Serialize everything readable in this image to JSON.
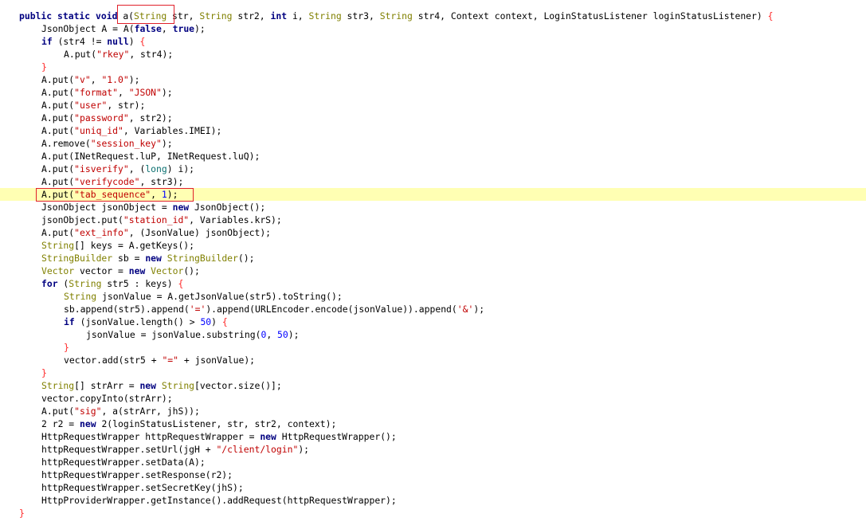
{
  "editor": {
    "highlighted_line": 15,
    "colors": {
      "keyword": "#000080",
      "type": "#808000",
      "string": "#c00000",
      "number": "#0000ff",
      "brace": "#ff2a2a",
      "cast": "#0b7070",
      "highlight_background": "#ffffb3",
      "annotation_box": "#e0202a"
    },
    "lines": [
      {
        "indent": 0,
        "tokens": [
          [
            "kw",
            "public static void "
          ],
          [
            "id",
            "a("
          ],
          [
            "type",
            "String"
          ],
          [
            "id",
            " str, "
          ],
          [
            "type",
            "String"
          ],
          [
            "id",
            " str2, "
          ],
          [
            "kw",
            "int"
          ],
          [
            "id",
            " i, "
          ],
          [
            "type",
            "String"
          ],
          [
            "id",
            " str3, "
          ],
          [
            "type",
            "String"
          ],
          [
            "id",
            " str4, Context context, LoginStatusListener loginStatusListener) "
          ],
          [
            "brace",
            "{"
          ]
        ]
      },
      {
        "indent": 4,
        "tokens": [
          [
            "id",
            "JsonObject A = A("
          ],
          [
            "kw",
            "false"
          ],
          [
            "id",
            ", "
          ],
          [
            "kw",
            "true"
          ],
          [
            "id",
            ");"
          ]
        ]
      },
      {
        "indent": 4,
        "tokens": [
          [
            "kw",
            "if"
          ],
          [
            "id",
            " (str4 != "
          ],
          [
            "kw",
            "null"
          ],
          [
            "id",
            ") "
          ],
          [
            "brace",
            "{"
          ]
        ]
      },
      {
        "indent": 8,
        "tokens": [
          [
            "id",
            "A.put("
          ],
          [
            "str",
            "\"rkey\""
          ],
          [
            "id",
            ", str4);"
          ]
        ]
      },
      {
        "indent": 4,
        "tokens": [
          [
            "brace",
            "}"
          ]
        ]
      },
      {
        "indent": 4,
        "tokens": [
          [
            "id",
            "A.put("
          ],
          [
            "str",
            "\"v\""
          ],
          [
            "id",
            ", "
          ],
          [
            "str",
            "\"1.0\""
          ],
          [
            "id",
            ");"
          ]
        ]
      },
      {
        "indent": 4,
        "tokens": [
          [
            "id",
            "A.put("
          ],
          [
            "str",
            "\"format\""
          ],
          [
            "id",
            ", "
          ],
          [
            "str",
            "\"JSON\""
          ],
          [
            "id",
            ");"
          ]
        ]
      },
      {
        "indent": 4,
        "tokens": [
          [
            "id",
            "A.put("
          ],
          [
            "str",
            "\"user\""
          ],
          [
            "id",
            ", str);"
          ]
        ]
      },
      {
        "indent": 4,
        "tokens": [
          [
            "id",
            "A.put("
          ],
          [
            "str",
            "\"password\""
          ],
          [
            "id",
            ", str2);"
          ]
        ]
      },
      {
        "indent": 4,
        "tokens": [
          [
            "id",
            "A.put("
          ],
          [
            "str",
            "\"uniq_id\""
          ],
          [
            "id",
            ", Variables.IMEI);"
          ]
        ]
      },
      {
        "indent": 4,
        "tokens": [
          [
            "id",
            "A.remove("
          ],
          [
            "str",
            "\"session_key\""
          ],
          [
            "id",
            ");"
          ]
        ]
      },
      {
        "indent": 4,
        "tokens": [
          [
            "id",
            "A.put(INetRequest.luP, INetRequest.luQ);"
          ]
        ]
      },
      {
        "indent": 4,
        "tokens": [
          [
            "id",
            "A.put("
          ],
          [
            "str",
            "\"isverify\""
          ],
          [
            "id",
            ", ("
          ],
          [
            "cast",
            "long"
          ],
          [
            "id",
            ") i);"
          ]
        ]
      },
      {
        "indent": 4,
        "tokens": [
          [
            "id",
            "A.put("
          ],
          [
            "str",
            "\"verifycode\""
          ],
          [
            "id",
            ", str3);"
          ]
        ]
      },
      {
        "indent": 4,
        "tokens": [
          [
            "id",
            "A.put("
          ],
          [
            "str",
            "\"tab_sequence\""
          ],
          [
            "id",
            ", "
          ],
          [
            "num",
            "1"
          ],
          [
            "id",
            ");"
          ]
        ]
      },
      {
        "indent": 4,
        "tokens": [
          [
            "id",
            "JsonObject jsonObject = "
          ],
          [
            "kw",
            "new"
          ],
          [
            "id",
            " JsonObject();"
          ]
        ]
      },
      {
        "indent": 4,
        "tokens": [
          [
            "id",
            "jsonObject.put("
          ],
          [
            "str",
            "\"station_id\""
          ],
          [
            "id",
            ", Variables.krS);"
          ]
        ]
      },
      {
        "indent": 4,
        "tokens": [
          [
            "id",
            "A.put("
          ],
          [
            "str",
            "\"ext_info\""
          ],
          [
            "id",
            ", (JsonValue) jsonObject);"
          ]
        ]
      },
      {
        "indent": 4,
        "tokens": [
          [
            "type",
            "String"
          ],
          [
            "id",
            "[] keys = A.getKeys();"
          ]
        ]
      },
      {
        "indent": 4,
        "tokens": [
          [
            "type",
            "StringBuilder"
          ],
          [
            "id",
            " sb = "
          ],
          [
            "kw",
            "new"
          ],
          [
            "id",
            " "
          ],
          [
            "type",
            "StringBuilder"
          ],
          [
            "id",
            "();"
          ]
        ]
      },
      {
        "indent": 4,
        "tokens": [
          [
            "type",
            "Vector"
          ],
          [
            "id",
            " vector = "
          ],
          [
            "kw",
            "new"
          ],
          [
            "id",
            " "
          ],
          [
            "type",
            "Vector"
          ],
          [
            "id",
            "();"
          ]
        ]
      },
      {
        "indent": 4,
        "tokens": [
          [
            "kw",
            "for"
          ],
          [
            "id",
            " ("
          ],
          [
            "type",
            "String"
          ],
          [
            "id",
            " str5 : keys) "
          ],
          [
            "brace",
            "{"
          ]
        ]
      },
      {
        "indent": 8,
        "tokens": [
          [
            "type",
            "String"
          ],
          [
            "id",
            " jsonValue = A.getJsonValue(str5).toString();"
          ]
        ]
      },
      {
        "indent": 8,
        "tokens": [
          [
            "id",
            "sb.append(str5).append("
          ],
          [
            "str",
            "'='"
          ],
          [
            "id",
            ").append(URLEncoder.encode(jsonValue)).append("
          ],
          [
            "str",
            "'&'"
          ],
          [
            "id",
            ");"
          ]
        ]
      },
      {
        "indent": 8,
        "tokens": [
          [
            "kw",
            "if"
          ],
          [
            "id",
            " (jsonValue.length() > "
          ],
          [
            "num",
            "50"
          ],
          [
            "id",
            ") "
          ],
          [
            "brace",
            "{"
          ]
        ]
      },
      {
        "indent": 12,
        "tokens": [
          [
            "id",
            "jsonValue = jsonValue.substring("
          ],
          [
            "num",
            "0"
          ],
          [
            "id",
            ", "
          ],
          [
            "num",
            "50"
          ],
          [
            "id",
            ");"
          ]
        ]
      },
      {
        "indent": 8,
        "tokens": [
          [
            "brace",
            "}"
          ]
        ]
      },
      {
        "indent": 8,
        "tokens": [
          [
            "id",
            "vector.add(str5 + "
          ],
          [
            "str",
            "\"=\""
          ],
          [
            "id",
            " + jsonValue);"
          ]
        ]
      },
      {
        "indent": 4,
        "tokens": [
          [
            "brace",
            "}"
          ]
        ]
      },
      {
        "indent": 4,
        "tokens": [
          [
            "type",
            "String"
          ],
          [
            "id",
            "[] strArr = "
          ],
          [
            "kw",
            "new"
          ],
          [
            "id",
            " "
          ],
          [
            "type",
            "String"
          ],
          [
            "id",
            "[vector.size()];"
          ]
        ]
      },
      {
        "indent": 4,
        "tokens": [
          [
            "id",
            "vector.copyInto(strArr);"
          ]
        ]
      },
      {
        "indent": 4,
        "tokens": [
          [
            "id",
            "A.put("
          ],
          [
            "str",
            "\"sig\""
          ],
          [
            "id",
            ", a(strArr, jhS));"
          ]
        ]
      },
      {
        "indent": 4,
        "tokens": [
          [
            "id",
            "2 r2 = "
          ],
          [
            "kw",
            "new"
          ],
          [
            "id",
            " 2(loginStatusListener, str, str2, context);"
          ]
        ]
      },
      {
        "indent": 4,
        "tokens": [
          [
            "id",
            "HttpRequestWrapper httpRequestWrapper = "
          ],
          [
            "kw",
            "new"
          ],
          [
            "id",
            " HttpRequestWrapper();"
          ]
        ]
      },
      {
        "indent": 4,
        "tokens": [
          [
            "id",
            "httpRequestWrapper.setUrl(jgH + "
          ],
          [
            "str",
            "\"/client/login\""
          ],
          [
            "id",
            ");"
          ]
        ]
      },
      {
        "indent": 4,
        "tokens": [
          [
            "id",
            "httpRequestWrapper.setData(A);"
          ]
        ]
      },
      {
        "indent": 4,
        "tokens": [
          [
            "id",
            "httpRequestWrapper.setResponse(r2);"
          ]
        ]
      },
      {
        "indent": 4,
        "tokens": [
          [
            "id",
            "httpRequestWrapper.setSecretKey(jhS);"
          ]
        ]
      },
      {
        "indent": 4,
        "tokens": [
          [
            "id",
            "HttpProviderWrapper.getInstance().addRequest(httpRequestWrapper);"
          ]
        ]
      },
      {
        "indent": 0,
        "tokens": [
          [
            "brace",
            "}"
          ]
        ]
      }
    ]
  }
}
